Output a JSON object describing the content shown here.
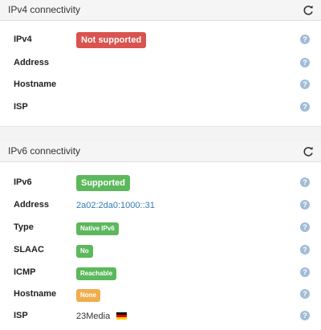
{
  "ipv4": {
    "title": "IPv4 connectivity",
    "rows": [
      {
        "label": "IPv4",
        "badge": "Not supported"
      },
      {
        "label": "Address"
      },
      {
        "label": "Hostname"
      },
      {
        "label": "ISP"
      }
    ]
  },
  "ipv6": {
    "title": "IPv6 connectivity",
    "rows": [
      {
        "label": "IPv6",
        "badge": "Supported"
      },
      {
        "label": "Address",
        "link": "2a02:2da0:1000::31"
      },
      {
        "label": "Type",
        "badge": "Native IPv6"
      },
      {
        "label": "SLAAC",
        "badge": "No"
      },
      {
        "label": "ICMP",
        "badge": "Reachable"
      },
      {
        "label": "Hostname",
        "badge": "None"
      },
      {
        "label": "ISP",
        "text": "23Media",
        "flag_icon": "germany-flag-icon"
      }
    ]
  },
  "icons": {
    "refresh": "refresh-icon",
    "help": "help-icon"
  },
  "help_glyph": "?",
  "colors": {
    "danger": "#d9534f",
    "success": "#5cb85c",
    "warning": "#f0ad4e",
    "link": "#337ab7",
    "help": "#a2bbd8"
  }
}
